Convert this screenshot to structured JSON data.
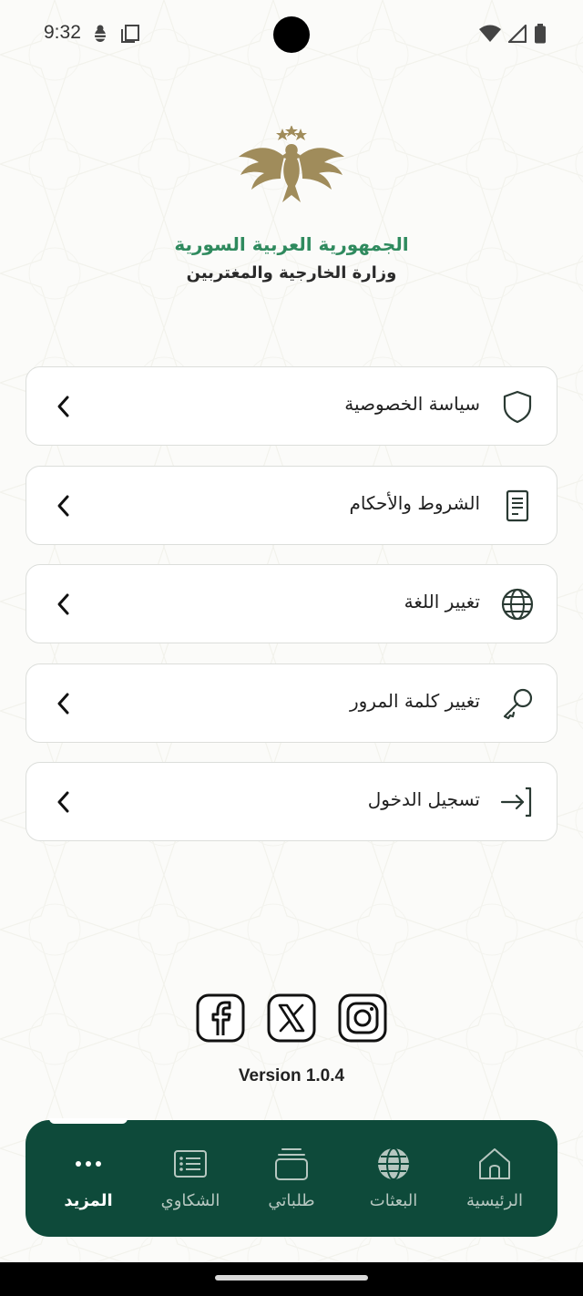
{
  "status_bar": {
    "time": "9:32",
    "icons_left": [
      "bug-icon",
      "clipboard-icon"
    ],
    "icons_right": [
      "wifi-icon",
      "signal-icon",
      "battery-icon"
    ]
  },
  "brand": {
    "title": "الجمهورية العربية السورية",
    "subtitle": "وزارة الخارجية والمغتربين",
    "logo": "eagle-emblem",
    "title_color": "#2f8a5e"
  },
  "menu": {
    "items": [
      {
        "label": "سياسة الخصوصية",
        "icon": "shield-icon"
      },
      {
        "label": "الشروط والأحكام",
        "icon": "document-icon"
      },
      {
        "label": "تغيير اللغة",
        "icon": "globe-icon"
      },
      {
        "label": "تغيير كلمة المرور",
        "icon": "key-icon"
      },
      {
        "label": "تسجيل الدخول",
        "icon": "login-icon"
      }
    ]
  },
  "social": [
    "facebook-icon",
    "x-icon",
    "instagram-icon"
  ],
  "version": "Version 1.0.4",
  "bottom_nav": {
    "background": "#0e4a3a",
    "items": [
      {
        "label": "المزيد",
        "icon": "more-icon",
        "active": true
      },
      {
        "label": "الشكاوي",
        "icon": "complaints-icon",
        "active": false
      },
      {
        "label": "طلباتي",
        "icon": "requests-icon",
        "active": false
      },
      {
        "label": "البعثات",
        "icon": "globe-icon",
        "active": false
      },
      {
        "label": "الرئيسية",
        "icon": "home-icon",
        "active": false
      }
    ]
  }
}
